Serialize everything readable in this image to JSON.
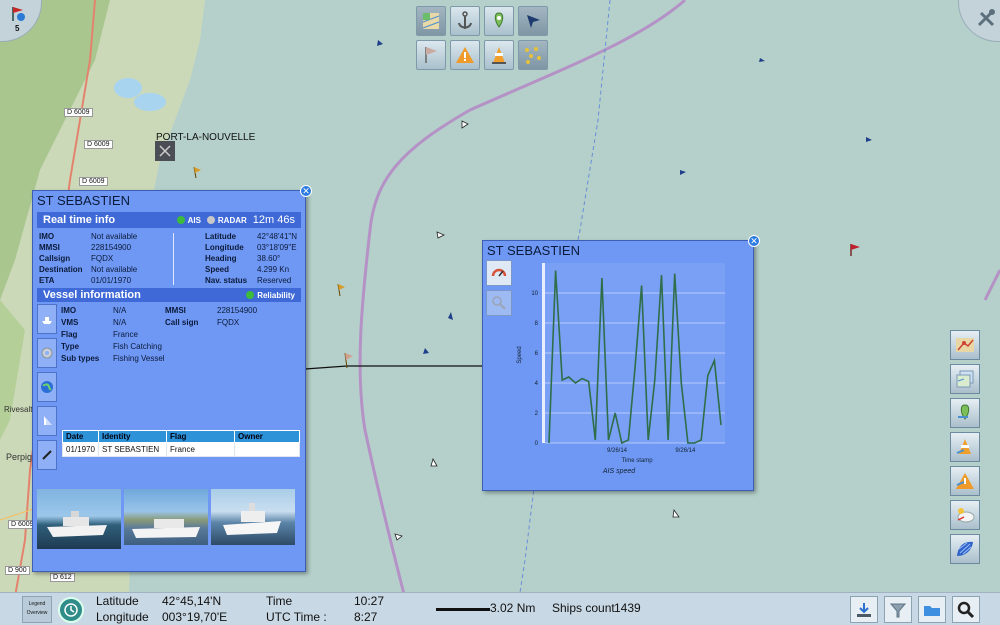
{
  "map": {
    "place_label": "PORT-LA-NOUVELLE",
    "town_labels": [
      "Perpignan",
      "Rivesaltes"
    ],
    "road_labels": [
      "D 6009",
      "D 6009",
      "D 6009",
      "D 6009",
      "D 612",
      "D 900"
    ],
    "notification_count": "5"
  },
  "vessel_panel": {
    "title": "ST SEBASTIEN",
    "realtime": {
      "heading": "Real time info",
      "source_ais": "AIS",
      "source_radar": "RADAR",
      "age": "12m 46s",
      "left": [
        {
          "k": "IMO",
          "v": "Not available"
        },
        {
          "k": "MMSI",
          "v": "228154900"
        },
        {
          "k": "Callsign",
          "v": "FQDX"
        },
        {
          "k": "Destination",
          "v": "Not available"
        },
        {
          "k": "ETA",
          "v": "01/01/1970"
        }
      ],
      "right": [
        {
          "k": "Latitude",
          "v": "42°48'41\"N"
        },
        {
          "k": "Longitude",
          "v": "03°18'09\"E"
        },
        {
          "k": "Heading",
          "v": "38.60°"
        },
        {
          "k": "Speed",
          "v": "4.299 Kn"
        },
        {
          "k": "Nav. status",
          "v": "Reserved"
        }
      ]
    },
    "vessel_info": {
      "heading": "Vessel information",
      "reliability": "Reliability",
      "left": [
        {
          "k": "IMO",
          "v": "N/A"
        },
        {
          "k": "VMS",
          "v": "N/A"
        },
        {
          "k": "Flag",
          "v": "France"
        },
        {
          "k": "Type",
          "v": "Fish Catching"
        },
        {
          "k": "Sub types",
          "v": "Fishing Vessel"
        }
      ],
      "right": [
        {
          "k": "MMSI",
          "v": "228154900"
        },
        {
          "k": "Call sign",
          "v": "FQDX"
        }
      ]
    },
    "history": {
      "columns": [
        "Date",
        "Identity",
        "Flag",
        "Owner"
      ],
      "rows": [
        [
          "01/1970",
          "ST SEBASTIEN",
          "France",
          ""
        ]
      ]
    }
  },
  "speed_panel": {
    "title": "ST SEBASTIEN"
  },
  "chart_data": {
    "type": "line",
    "title": "AIS speed",
    "xlabel": "Time stamp",
    "ylabel": "Speed",
    "ylim": [
      0,
      12
    ],
    "yticks": [
      0,
      2,
      4,
      6,
      8,
      10
    ],
    "xtick_labels": [
      "9/26/14",
      "9/26/14"
    ],
    "grid": true,
    "series": [
      {
        "values": [
          0,
          11.5,
          4.2,
          4.4,
          4.0,
          4.3,
          4.1,
          0.2,
          11.0,
          0.2,
          2.0,
          0,
          0.2,
          5.0,
          10.5,
          0.2,
          4.2,
          11.2,
          0.2,
          11.3,
          4.0,
          0,
          0,
          0.2,
          4.5,
          5.5,
          1.2
        ]
      }
    ]
  },
  "status": {
    "legend_label": "Legend",
    "overview_label": "Overview",
    "lat_label": "Latitude",
    "lat_value": "42°45,14'N",
    "lon_label": "Longitude",
    "lon_value": "003°19,70'E",
    "time_label": "Time",
    "time_value": "10:27",
    "utc_label": "UTC Time :",
    "utc_value": "8:27",
    "scale": "3.02 Nm",
    "ships_label": "Ships count",
    "ships_value": "1439"
  }
}
